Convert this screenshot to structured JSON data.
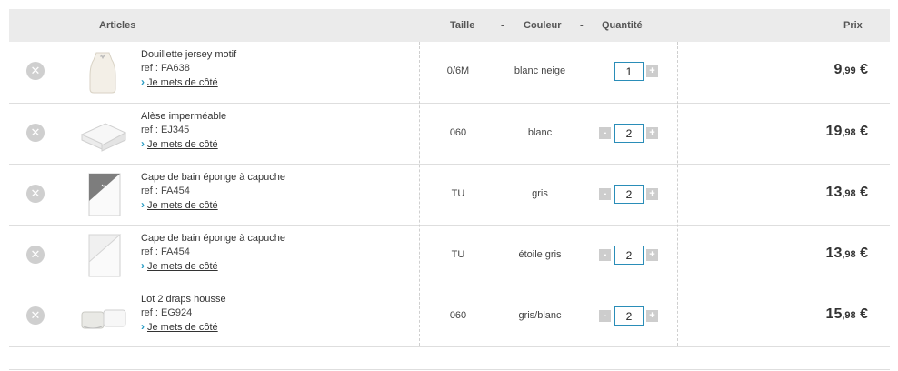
{
  "header": {
    "articles": "Articles",
    "taille": "Taille",
    "sep": "-",
    "couleur": "Couleur",
    "quantite": "Quantité",
    "prix": "Prix"
  },
  "save_link_label": "Je mets de côté",
  "remove_icon": "close-circle-icon",
  "currency": "€",
  "items": [
    {
      "name": "Douillette jersey motif",
      "ref": "ref : FA638",
      "size": "0/6M",
      "color": "blanc neige",
      "qty": "1",
      "price_int": "9",
      "price_cents": ",99",
      "show_minus": false,
      "thumb": "sleeping-bag"
    },
    {
      "name": "Alèse imperméable",
      "ref": "ref : EJ345",
      "size": "060",
      "color": "blanc",
      "qty": "2",
      "price_int": "19",
      "price_cents": ",98",
      "show_minus": true,
      "thumb": "folded-sheet"
    },
    {
      "name": "Cape de bain éponge à capuche",
      "ref": "ref : FA454",
      "size": "TU",
      "color": "gris",
      "qty": "2",
      "price_int": "13",
      "price_cents": ",98",
      "show_minus": true,
      "thumb": "towel-grey"
    },
    {
      "name": "Cape de bain éponge à capuche",
      "ref": "ref : FA454",
      "size": "TU",
      "color": "étoile gris",
      "qty": "2",
      "price_int": "13",
      "price_cents": ",98",
      "show_minus": true,
      "thumb": "towel-star"
    },
    {
      "name": "Lot 2 draps housse",
      "ref": "ref : EG924",
      "size": "060",
      "color": "gris/blanc",
      "qty": "2",
      "price_int": "15",
      "price_cents": ",98",
      "show_minus": true,
      "thumb": "fitted-sheets"
    }
  ]
}
